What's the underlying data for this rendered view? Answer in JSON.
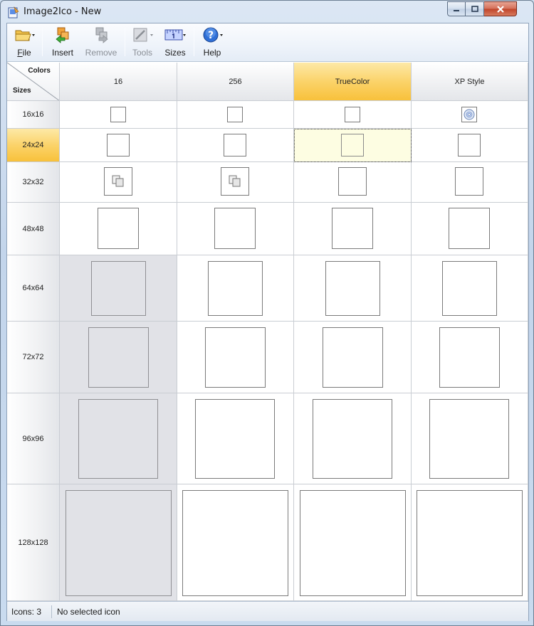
{
  "window": {
    "title": "Image2Ico - New"
  },
  "toolbar": {
    "file": {
      "label": "File",
      "accel": "F",
      "rest": "ile",
      "icon": "folder-icon"
    },
    "insert": {
      "label": "Insert",
      "icon": "insert-image-icon"
    },
    "remove": {
      "label": "Remove",
      "icon": "remove-image-icon",
      "enabled": false
    },
    "tools": {
      "label": "Tools",
      "icon": "tools-icon",
      "enabled": false
    },
    "sizes": {
      "label": "Sizes",
      "icon": "ruler-icon"
    },
    "help": {
      "label": "Help",
      "icon": "help-icon"
    }
  },
  "grid": {
    "corner": {
      "colors_label": "Colors",
      "sizes_label": "Sizes"
    },
    "columns": [
      "16",
      "256",
      "TrueColor",
      "XP Style"
    ],
    "active_column": 2,
    "rows": [
      "16x16",
      "24x24",
      "32x32",
      "48x48",
      "64x64",
      "72x72",
      "96x96",
      "128x128"
    ],
    "active_row": 1,
    "selected_cell": {
      "row": 1,
      "column": 2
    },
    "disabled_cells": "column 0 for rows 64x64, 72x72, 96x96, 128x128",
    "icon_content": {
      "16x16 / XP Style": "cd-icon",
      "32x32 / 16": "copy-icon",
      "32x32 / 256": "copy-icon"
    }
  },
  "statusbar": {
    "icons_count": "Icons: 3",
    "selection": "No selected icon"
  },
  "colors": {
    "active_header": "#f8c13b",
    "selected_cell": "#fdfde2",
    "disabled_cell": "#e1e2e7"
  }
}
